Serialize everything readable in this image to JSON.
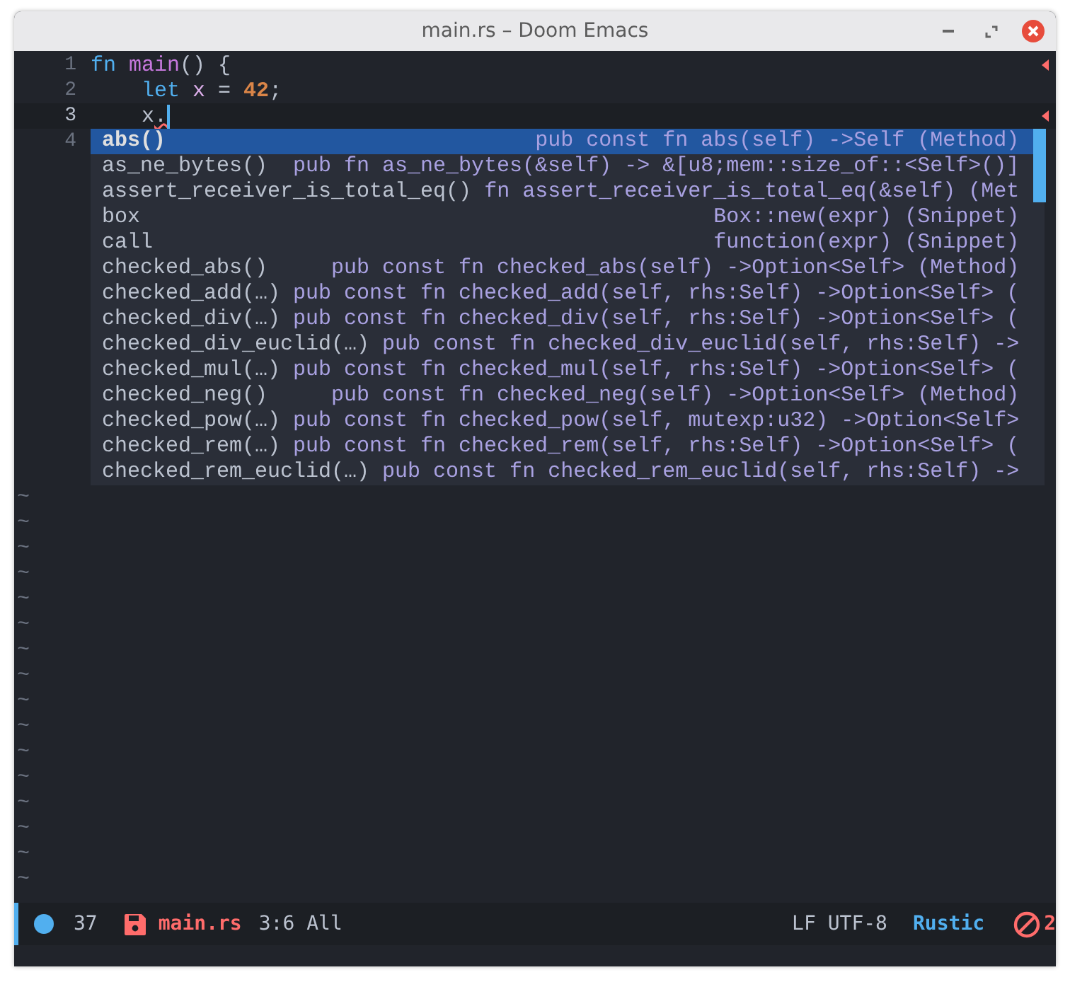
{
  "window": {
    "title": "main.rs – Doom Emacs"
  },
  "lines": [
    {
      "number": "1",
      "current": false,
      "flagged": true,
      "cursor": false,
      "tokens": [
        {
          "text": "fn ",
          "kind": "keyword"
        },
        {
          "text": "main",
          "kind": "function"
        },
        {
          "text": "() {",
          "kind": "plain"
        }
      ]
    },
    {
      "number": "2",
      "current": false,
      "flagged": false,
      "cursor": false,
      "tokens": [
        {
          "text": "    let ",
          "kind": "keyword"
        },
        {
          "text": "x",
          "kind": "variable"
        },
        {
          "text": " = ",
          "kind": "plain"
        },
        {
          "text": "42",
          "kind": "number"
        },
        {
          "text": ";",
          "kind": "plain"
        }
      ]
    },
    {
      "number": "3",
      "current": true,
      "flagged": true,
      "cursor": true,
      "tokens": [
        {
          "text": "    x",
          "kind": "plain"
        },
        {
          "text": ".",
          "kind": "error"
        }
      ]
    },
    {
      "number": "4",
      "current": false,
      "flagged": false,
      "cursor": false
    }
  ],
  "completions": [
    {
      "candidate": "abs()",
      "annotation": "pub const fn abs(self) ->Self (Method)",
      "selected": true
    },
    {
      "candidate": "as_ne_bytes()",
      "annotation": "pub fn as_ne_bytes(&self) -> &[u8;mem::size_of::<Self>()]",
      "selected": false
    },
    {
      "candidate": "assert_receiver_is_total_eq()",
      "annotation": "fn assert_receiver_is_total_eq(&self) (Met",
      "selected": false
    },
    {
      "candidate": "box",
      "annotation": "Box::new(expr) (Snippet)",
      "selected": false
    },
    {
      "candidate": "call",
      "annotation": "function(expr) (Snippet)",
      "selected": false
    },
    {
      "candidate": "checked_abs()",
      "annotation": "pub const fn checked_abs(self) ->Option<Self> (Method)",
      "selected": false
    },
    {
      "candidate": "checked_add(…)",
      "annotation": "pub const fn checked_add(self, rhs:Self) ->Option<Self> (",
      "selected": false
    },
    {
      "candidate": "checked_div(…)",
      "annotation": "pub const fn checked_div(self, rhs:Self) ->Option<Self> (",
      "selected": false
    },
    {
      "candidate": "checked_div_euclid(…)",
      "annotation": "pub const fn checked_div_euclid(self, rhs:Self) ->",
      "selected": false
    },
    {
      "candidate": "checked_mul(…)",
      "annotation": "pub const fn checked_mul(self, rhs:Self) ->Option<Self> (",
      "selected": false
    },
    {
      "candidate": "checked_neg()",
      "annotation": "pub const fn checked_neg(self) ->Option<Self> (Method)",
      "selected": false
    },
    {
      "candidate": "checked_pow(…)",
      "annotation": "pub const fn checked_pow(self, mutexp:u32) ->Option<Self>",
      "selected": false
    },
    {
      "candidate": "checked_rem(…)",
      "annotation": "pub const fn checked_rem(self, rhs:Self) ->Option<Self> (",
      "selected": false
    },
    {
      "candidate": "checked_rem_euclid(…)",
      "annotation": "pub const fn checked_rem_euclid(self, rhs:Self) ->",
      "selected": false
    }
  ],
  "empty_line_markers": [
    "~",
    "~",
    "~",
    "~",
    "~",
    "~",
    "~",
    "~",
    "~",
    "~",
    "~",
    "~",
    "~",
    "~",
    "~",
    "~"
  ],
  "status_bar": {
    "buffer_size": "37",
    "file_name": "main.rs",
    "position": "3:6 All",
    "encoding": "LF UTF-8",
    "mode": "Rustic",
    "error_count": "2"
  }
}
